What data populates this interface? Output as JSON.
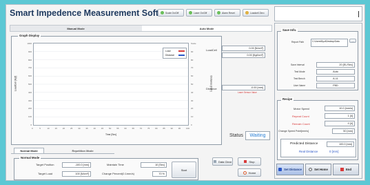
{
  "app": {
    "title": "Smart Impedence Measurement Software"
  },
  "toolbar": [
    {
      "label": "Scale On/Off",
      "icon": "scale-icon",
      "color": "#6bbf5a"
    },
    {
      "label": "Laser On/Off",
      "icon": "laser-icon",
      "color": "#6bbf5a"
    },
    {
      "label": "Alarm Reset",
      "icon": "alarm-reset-icon",
      "color": "#6bbf5a"
    },
    {
      "label": "Loadcell Zero",
      "icon": "loadcell-zero-icon",
      "color": "#e0b040"
    }
  ],
  "mode_tabs": [
    "Manual Mode",
    "Auto Mode"
  ],
  "graph": {
    "title": "Graph Display",
    "y_left_label": "LoadCell [Kgf]",
    "y_right_label": "Distance [mm]",
    "x_label": "Time [Sec]",
    "y_left_ticks": [
      "1000",
      "900",
      "800",
      "700",
      "600",
      "500",
      "400",
      "300",
      "200",
      "100",
      "0"
    ],
    "y_right_ticks": [
      "Scale",
      "90",
      "80",
      "70",
      "60",
      "50",
      "40",
      "30",
      "20",
      "10",
      "0"
    ],
    "x_ticks": [
      "0",
      "5",
      "10",
      "15",
      "20",
      "25",
      "30",
      "35",
      "40",
      "45",
      "50",
      "55",
      "60",
      "65",
      "70",
      "75",
      "80",
      "85",
      "90",
      "95",
      "100"
    ],
    "legend": [
      {
        "name": "Load",
        "color": "#d83a3a"
      },
      {
        "name": "Distance",
        "color": "#2a56c6"
      }
    ]
  },
  "readouts": {
    "loadcell_label": "LoadCell",
    "loadcell_n": "0.00 [N/cm²]",
    "loadcell_kgf": "0.00 [Kgf/cm²]",
    "distance_label": "Distance",
    "distance_value": "-0.00 [mm]",
    "distance_sub": "Laser Sensor Value",
    "status_label": "Status",
    "status_value": "Waiting"
  },
  "sub_tabs": [
    "Normal Mode",
    "Repetition Mode"
  ],
  "normal_mode": {
    "title": "Normal Mode",
    "target_position_label": "Target Position",
    "target_position_value": "-100.0 [mm]",
    "target_load_label": "Target Load",
    "target_load_value": "100 [N/cm²]",
    "maintain_time_label": "Maintain Time",
    "maintain_time_value": "10 [Sec]",
    "change_percent_label": "Change Percent(0.1mm/s)",
    "change_percent_value": "70 %",
    "start_label": "Start"
  },
  "controls": {
    "data_clear_label": "Data Clear",
    "stop_label": "Stop",
    "home_label": "Home",
    "stop_color": "#d83a3a",
    "home_color": "#e06030"
  },
  "save_info": {
    "title": "Save Info.",
    "report_path_label": "Report Path",
    "report_path_value": "C:\\Users\\Byul\\Desktop\\Data",
    "browse_label": "...",
    "save_interval_label": "Save Interval",
    "save_interval_value": "20 [EL/Sec]",
    "test_mode_label": "Test Mode",
    "test_mode_value": "Auto",
    "test_bench_label": "Test Bench",
    "test_bench_value": "A-11",
    "user_name_label": "User Name",
    "user_name_value": "FBD"
  },
  "recipe": {
    "title": "Recipe",
    "motor_speed_label": "Motor Speed",
    "motor_speed_value": "10.0 [mm/s]",
    "repeat_count_label": "Repeat Count",
    "repeat_count_value": "1 [4]",
    "remain_count_label": "Remain Count",
    "remain_count_value": "0 [4]",
    "change_speed_label": "Change Speed Point[mm/s]",
    "change_speed_value": "50 [mm]",
    "predicted_label": "Predicted Distance",
    "predicted_value": "100.0 [mm]",
    "real_label": "Real Distance",
    "real_value": "0 [mm]"
  },
  "bottom_buttons": [
    {
      "label": "Set Distance",
      "icon": "set-distance-icon"
    },
    {
      "label": "Set Home",
      "icon": "set-home-icon"
    },
    {
      "label": "End",
      "icon": "end-icon"
    }
  ]
}
